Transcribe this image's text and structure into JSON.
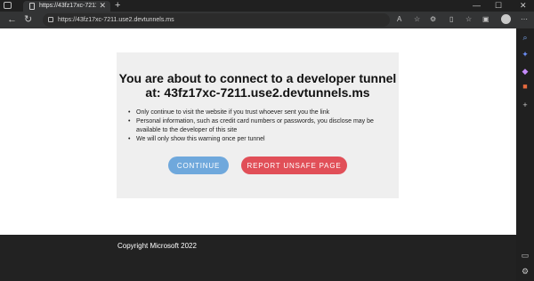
{
  "browser": {
    "tab": {
      "title": "https://43fz17xc-7211.use2.devtu",
      "close": "✕"
    },
    "new_tab": "+",
    "window_controls": {
      "minimize": "—",
      "maximize": "☐",
      "close": "✕"
    },
    "address": {
      "url": "https://43fz17xc-7211.use2.devtunnels.ms"
    },
    "nav": {
      "back": "←",
      "refresh": "↻"
    },
    "toolbar_icons": [
      "read-aloud-icon",
      "favorites-add-icon",
      "extensions-icon",
      "split-screen-icon",
      "favorites-icon",
      "collections-icon",
      "profile-icon",
      "more-icon"
    ],
    "sidebar_icons": [
      "search-icon",
      "copilot-icon",
      "shopping-icon",
      "office-icon",
      "add-icon",
      "layout-icon",
      "settings-icon"
    ]
  },
  "warning": {
    "title_line1": "You are about to connect to a developer tunnel",
    "title_line2": "at: 43fz17xc-7211.use2.devtunnels.ms",
    "bullets": [
      "Only continue to visit the website if you trust whoever sent you the link",
      "Personal information, such as credit card numbers or passwords, you disclose may be available to the developer of this site",
      "We will only show this warning once per tunnel"
    ],
    "continue_label": "CONTINUE",
    "report_label": "REPORT UNSAFE PAGE"
  },
  "footer": {
    "copyright": "Copyright Microsoft 2022"
  },
  "colors": {
    "continue": "#6fa8dc",
    "report": "#e14f58",
    "card": "#efefef",
    "footer": "#222222"
  }
}
